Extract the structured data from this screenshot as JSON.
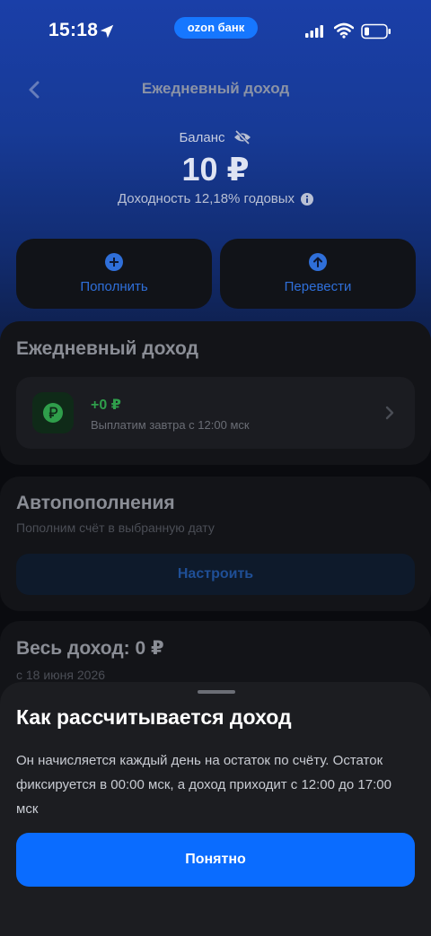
{
  "status_bar": {
    "time": "15:18",
    "bank_badge": "ozon банк",
    "icons": [
      "location-arrow-icon",
      "cellular-signal-icon",
      "wifi-icon",
      "battery-icon"
    ]
  },
  "header": {
    "title": "Ежедневный доход",
    "back_icon": "chevron-left-icon"
  },
  "balance": {
    "label": "Баланс",
    "value": "10 ₽",
    "yield_text": "Доходность 12,18% годовых",
    "icons": [
      "eye-off-icon",
      "info-icon"
    ]
  },
  "actions": [
    {
      "label": "Пополнить",
      "icon": "plus-circle-icon"
    },
    {
      "label": "Перевести",
      "icon": "arrow-up-circle-icon"
    }
  ],
  "daily_income": {
    "title": "Ежедневный доход",
    "amount": "+0 ₽",
    "note": "Выплатим завтра с 12:00 мск",
    "icon": "ruble-icon"
  },
  "auto_topups": {
    "title": "Автопополнения",
    "subtitle": "Пополним счёт в выбранную дату",
    "button": "Настроить"
  },
  "total_income": {
    "title": "Весь доход: 0 ₽",
    "since": "с 18 июня 2026"
  },
  "sheet": {
    "title": "Как рассчитывается доход",
    "text": "Он начисляется каждый день на остаток по счёту. Остаток фиксируется в 00:00 мск, а доход приходит с 12:00 до 17:00 мск",
    "button": "Понятно"
  },
  "colors": {
    "accent": "#0a6cff",
    "positive": "#2f9e4b",
    "sheet_bg": "#1c1d21"
  }
}
